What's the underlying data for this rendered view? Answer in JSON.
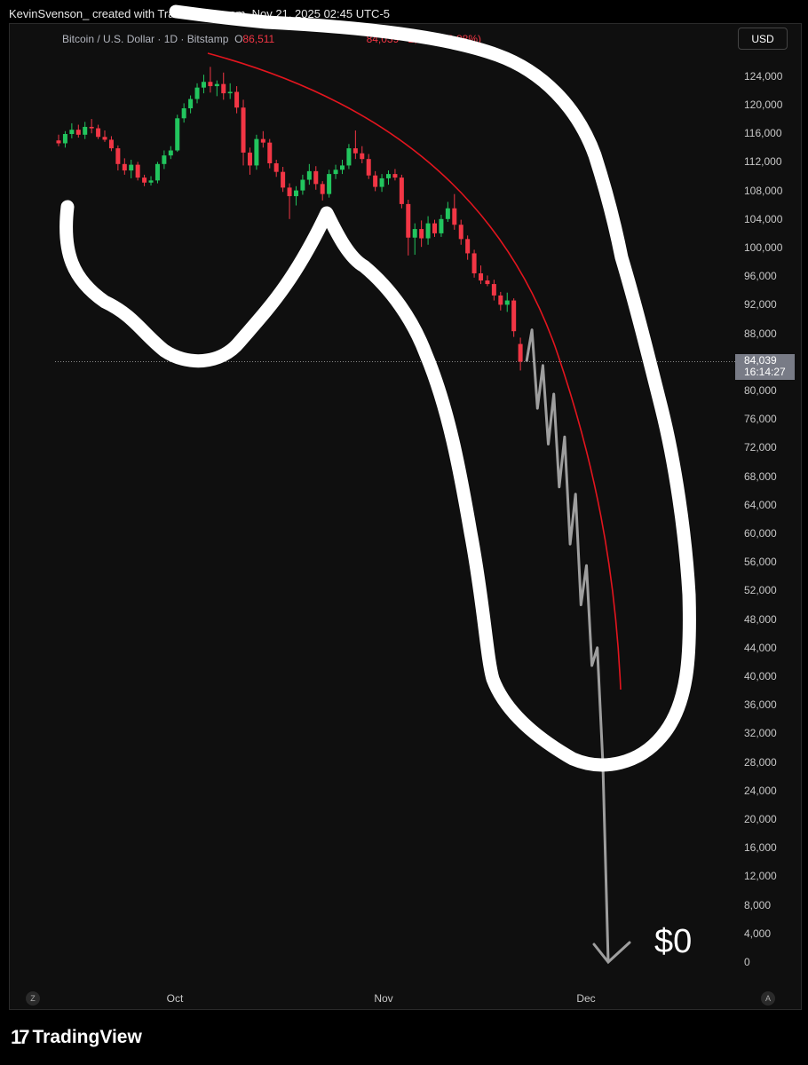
{
  "header": {
    "attribution": "KevinSvenson_ created with TradingView.com, Nov 21, 2025 02:45 UTC-5"
  },
  "legend": {
    "symbol": "Bitcoin / U.S. Dollar · 1D · Bitstamp",
    "open_label": "O",
    "open_value": "86,511",
    "close_value": "84,039",
    "change": "−2,488 (−2.88%)"
  },
  "currency_button": "USD",
  "price_tag": {
    "price": "84,039",
    "countdown": "16:14:27"
  },
  "axis": {
    "y_ticks": [
      "124,000",
      "120,000",
      "116,000",
      "112,000",
      "108,000",
      "104,000",
      "100,000",
      "96,000",
      "92,000",
      "88,000",
      "80,000",
      "76,000",
      "72,000",
      "68,000",
      "64,000",
      "60,000",
      "56,000",
      "52,000",
      "48,000",
      "44,000",
      "40,000",
      "36,000",
      "32,000",
      "28,000",
      "24,000",
      "20,000",
      "16,000",
      "12,000",
      "8,000",
      "4,000",
      "0"
    ],
    "x_ticks": [
      "Oct",
      "Nov",
      "Dec"
    ]
  },
  "controls": {
    "left_button": "Z",
    "right_button": "A"
  },
  "annotation": {
    "target_label": "$0"
  },
  "brand": {
    "name": "TradingView"
  },
  "colors": {
    "up": "#22c55e",
    "down": "#f23645",
    "curve": "#e3151e",
    "projection": "#9e9e9e",
    "drawing": "#ffffff"
  },
  "chart_data": {
    "type": "candlestick",
    "symbol": "Bitcoin / U.S. Dollar",
    "interval": "1D",
    "exchange": "Bitstamp",
    "ylim": [
      0,
      126000
    ],
    "last_price": 84039,
    "candles": [
      {
        "o": 115000,
        "h": 115800,
        "l": 114200,
        "c": 114600
      },
      {
        "o": 114600,
        "h": 116300,
        "l": 114000,
        "c": 115900
      },
      {
        "o": 115900,
        "h": 117400,
        "l": 115300,
        "c": 116500
      },
      {
        "o": 116500,
        "h": 117200,
        "l": 115400,
        "c": 115800
      },
      {
        "o": 115800,
        "h": 117600,
        "l": 115200,
        "c": 116900
      },
      {
        "o": 116900,
        "h": 118000,
        "l": 116000,
        "c": 116700
      },
      {
        "o": 116700,
        "h": 117200,
        "l": 115200,
        "c": 115500
      },
      {
        "o": 115500,
        "h": 116400,
        "l": 114800,
        "c": 115100
      },
      {
        "o": 115100,
        "h": 115600,
        "l": 113500,
        "c": 113900
      },
      {
        "o": 113900,
        "h": 114300,
        "l": 110800,
        "c": 111700
      },
      {
        "o": 111700,
        "h": 112500,
        "l": 110200,
        "c": 110800
      },
      {
        "o": 110800,
        "h": 112300,
        "l": 109700,
        "c": 111600
      },
      {
        "o": 111600,
        "h": 112000,
        "l": 109400,
        "c": 109800
      },
      {
        "o": 109800,
        "h": 110200,
        "l": 108600,
        "c": 109100
      },
      {
        "o": 109100,
        "h": 110000,
        "l": 108700,
        "c": 109400
      },
      {
        "o": 109400,
        "h": 112000,
        "l": 109000,
        "c": 111700
      },
      {
        "o": 111700,
        "h": 113600,
        "l": 111000,
        "c": 112900
      },
      {
        "o": 112900,
        "h": 114200,
        "l": 112400,
        "c": 113600
      },
      {
        "o": 113600,
        "h": 118600,
        "l": 113400,
        "c": 118100
      },
      {
        "o": 118100,
        "h": 120200,
        "l": 117500,
        "c": 119500
      },
      {
        "o": 119500,
        "h": 121300,
        "l": 118800,
        "c": 120800
      },
      {
        "o": 120800,
        "h": 123000,
        "l": 120200,
        "c": 122400
      },
      {
        "o": 122400,
        "h": 124200,
        "l": 121600,
        "c": 123200
      },
      {
        "o": 123200,
        "h": 125300,
        "l": 121700,
        "c": 122600
      },
      {
        "o": 122600,
        "h": 123400,
        "l": 121200,
        "c": 122900
      },
      {
        "o": 122900,
        "h": 124500,
        "l": 120700,
        "c": 121600
      },
      {
        "o": 121600,
        "h": 123000,
        "l": 120800,
        "c": 121800
      },
      {
        "o": 121800,
        "h": 122600,
        "l": 118800,
        "c": 119600
      },
      {
        "o": 119600,
        "h": 120700,
        "l": 111500,
        "c": 113300
      },
      {
        "o": 113300,
        "h": 114000,
        "l": 110200,
        "c": 111500
      },
      {
        "o": 111500,
        "h": 115800,
        "l": 110900,
        "c": 115200
      },
      {
        "o": 115200,
        "h": 116300,
        "l": 114000,
        "c": 114700
      },
      {
        "o": 114700,
        "h": 115200,
        "l": 111100,
        "c": 111800
      },
      {
        "o": 111800,
        "h": 112300,
        "l": 109900,
        "c": 110600
      },
      {
        "o": 110600,
        "h": 111300,
        "l": 107800,
        "c": 108400
      },
      {
        "o": 108400,
        "h": 109000,
        "l": 104000,
        "c": 107200
      },
      {
        "o": 107200,
        "h": 108600,
        "l": 105900,
        "c": 108000
      },
      {
        "o": 108000,
        "h": 110200,
        "l": 107400,
        "c": 109500
      },
      {
        "o": 109500,
        "h": 111700,
        "l": 108800,
        "c": 110700
      },
      {
        "o": 110700,
        "h": 111400,
        "l": 108100,
        "c": 108900
      },
      {
        "o": 108900,
        "h": 109300,
        "l": 106600,
        "c": 107500
      },
      {
        "o": 107500,
        "h": 110900,
        "l": 107000,
        "c": 110300
      },
      {
        "o": 110300,
        "h": 111600,
        "l": 109600,
        "c": 110900
      },
      {
        "o": 110900,
        "h": 112300,
        "l": 110300,
        "c": 111500
      },
      {
        "o": 111500,
        "h": 114500,
        "l": 111000,
        "c": 113900
      },
      {
        "o": 113900,
        "h": 116400,
        "l": 112400,
        "c": 113200
      },
      {
        "o": 113200,
        "h": 114200,
        "l": 111800,
        "c": 112400
      },
      {
        "o": 112400,
        "h": 113100,
        "l": 109600,
        "c": 110100
      },
      {
        "o": 110100,
        "h": 110700,
        "l": 107900,
        "c": 108500
      },
      {
        "o": 108500,
        "h": 110300,
        "l": 107800,
        "c": 109700
      },
      {
        "o": 109700,
        "h": 110800,
        "l": 108800,
        "c": 110300
      },
      {
        "o": 110300,
        "h": 111000,
        "l": 109400,
        "c": 109800
      },
      {
        "o": 109800,
        "h": 110200,
        "l": 105500,
        "c": 106100
      },
      {
        "o": 106100,
        "h": 106700,
        "l": 98900,
        "c": 101400
      },
      {
        "o": 101400,
        "h": 103400,
        "l": 99000,
        "c": 102600
      },
      {
        "o": 102600,
        "h": 103800,
        "l": 100100,
        "c": 101300
      },
      {
        "o": 101300,
        "h": 104400,
        "l": 100400,
        "c": 103400
      },
      {
        "o": 103400,
        "h": 103900,
        "l": 101500,
        "c": 102000
      },
      {
        "o": 102000,
        "h": 104600,
        "l": 101500,
        "c": 104000
      },
      {
        "o": 104000,
        "h": 106400,
        "l": 103600,
        "c": 105500
      },
      {
        "o": 105500,
        "h": 107500,
        "l": 102500,
        "c": 103200
      },
      {
        "o": 103200,
        "h": 103900,
        "l": 100400,
        "c": 101200
      },
      {
        "o": 101200,
        "h": 101700,
        "l": 98300,
        "c": 99200
      },
      {
        "o": 99200,
        "h": 99700,
        "l": 95800,
        "c": 96400
      },
      {
        "o": 96400,
        "h": 97500,
        "l": 94900,
        "c": 95400
      },
      {
        "o": 95400,
        "h": 96100,
        "l": 94600,
        "c": 94900
      },
      {
        "o": 94900,
        "h": 95500,
        "l": 92600,
        "c": 93300
      },
      {
        "o": 93300,
        "h": 93800,
        "l": 91200,
        "c": 92000
      },
      {
        "o": 92000,
        "h": 93700,
        "l": 91000,
        "c": 92600
      },
      {
        "o": 92600,
        "h": 92900,
        "l": 87500,
        "c": 88300
      },
      {
        "o": 86511,
        "h": 87400,
        "l": 82800,
        "c": 84039
      }
    ],
    "projection_path": [
      [
        85000,
        84039
      ],
      [
        86000,
        88500
      ],
      [
        87000,
        77500
      ],
      [
        88000,
        83500
      ],
      [
        89000,
        72500
      ],
      [
        90000,
        79500
      ],
      [
        91000,
        66500
      ],
      [
        92000,
        73500
      ],
      [
        93000,
        58500
      ],
      [
        94000,
        65500
      ],
      [
        95000,
        50000
      ],
      [
        96000,
        55500
      ],
      [
        97000,
        41500
      ],
      [
        98000,
        44000
      ],
      [
        99000,
        28000
      ],
      [
        100000,
        0
      ]
    ]
  }
}
